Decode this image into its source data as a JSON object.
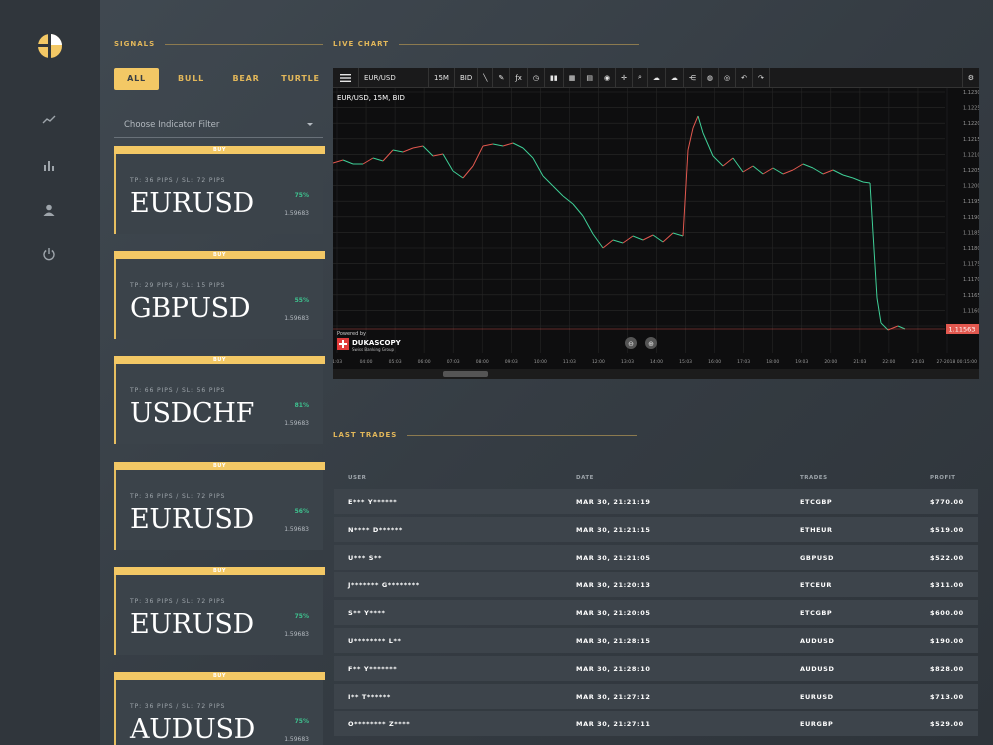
{
  "sections": {
    "signals": "SIGNALS",
    "live_chart": "LIVE CHART",
    "last_trades": "LAST TRADES"
  },
  "filters": [
    {
      "label": "ALL",
      "active": true
    },
    {
      "label": "BULL",
      "active": false
    },
    {
      "label": "BEAR",
      "active": false
    },
    {
      "label": "TURTLE",
      "active": false
    }
  ],
  "indicator_filter": {
    "placeholder": "Choose Indicator Filter"
  },
  "signals": [
    {
      "badge": "BUY",
      "tp_sl": "TP: 36 PIPS / SL: 72 PIPS",
      "pair": "EURUSD",
      "pct": "75%",
      "price": "1.59683"
    },
    {
      "badge": "BUY",
      "tp_sl": "TP: 29 PIPS / SL: 15 PIPS",
      "pair": "GBPUSD",
      "pct": "55%",
      "price": "1.59683"
    },
    {
      "badge": "BUY",
      "tp_sl": "TP: 66 PIPS / SL: 56 PIPS",
      "pair": "USDCHF",
      "pct": "81%",
      "price": "1.59683"
    },
    {
      "badge": "BUY",
      "tp_sl": "TP: 36 PIPS / SL: 72 PIPS",
      "pair": "EURUSD",
      "pct": "56%",
      "price": "1.59683"
    },
    {
      "badge": "BUY",
      "tp_sl": "TP: 36 PIPS / SL: 72 PIPS",
      "pair": "EURUSD",
      "pct": "75%",
      "price": "1.59683"
    },
    {
      "badge": "BUY",
      "tp_sl": "TP: 36 PIPS / SL: 72 PIPS",
      "pair": "AUDUSD",
      "pct": "75%",
      "price": "1.59683"
    }
  ],
  "chart": {
    "symbol": "EUR/USD",
    "timeframe": "15M",
    "price_type": "BID",
    "legend": "EUR/USD, 15M, BID",
    "powered_by": "Powered by",
    "provider": "DUKASCOPY",
    "provider_sub": "Swiss Banking Group",
    "current_price": "1.11563",
    "y_ticks": [
      "1.12300",
      "1.12250",
      "1.12200",
      "1.12150",
      "1.12100",
      "1.12050",
      "1.12000",
      "1.11950",
      "1.11900",
      "1.11850",
      "1.11800",
      "1.11750",
      "1.11700",
      "1.11650",
      "1.11600",
      "1.11550"
    ],
    "x_ticks": [
      "1:03",
      "04:00",
      "05:03",
      "06:00",
      "07:03",
      "08:00",
      "09:03",
      "10:00",
      "11:03",
      "12:00",
      "13:03",
      "14:00",
      "15:03",
      "16:00",
      "17:03",
      "18:00",
      "19:03",
      "20:00",
      "21:03",
      "22:00",
      "23:03",
      "27-2018 00:15:00"
    ],
    "colors": {
      "up": "#e2584f",
      "down": "#3fcf97",
      "price_tag": "#e2584f"
    }
  },
  "trades": {
    "headers": {
      "user": "USER",
      "date": "DATE",
      "trades": "TRADES",
      "profit": "PROFIT"
    },
    "rows": [
      {
        "user": "E*** Y******",
        "date": "MAR 30, 21:21:19",
        "pair": "ETCGBP",
        "profit": "$770.00"
      },
      {
        "user": "N**** D******",
        "date": "MAR 30, 21:21:15",
        "pair": "ETHEUR",
        "profit": "$519.00"
      },
      {
        "user": "U*** S**",
        "date": "MAR 30, 21:21:05",
        "pair": "GBPUSD",
        "profit": "$522.00"
      },
      {
        "user": "J******* G********",
        "date": "MAR 30, 21:20:13",
        "pair": "ETCEUR",
        "profit": "$311.00"
      },
      {
        "user": "S** Y****",
        "date": "MAR 30, 21:20:05",
        "pair": "ETCGBP",
        "profit": "$600.00"
      },
      {
        "user": "U******** L**",
        "date": "MAR 30, 21:28:15",
        "pair": "AUDUSD",
        "profit": "$190.00"
      },
      {
        "user": "F** Y*******",
        "date": "MAR 30, 21:28:10",
        "pair": "AUDUSD",
        "profit": "$828.00"
      },
      {
        "user": "I** T******",
        "date": "MAR 30, 21:27:12",
        "pair": "EURUSD",
        "profit": "$713.00"
      },
      {
        "user": "O******** Z****",
        "date": "MAR 30, 21:27:11",
        "pair": "EURGBP",
        "profit": "$529.00"
      }
    ]
  }
}
